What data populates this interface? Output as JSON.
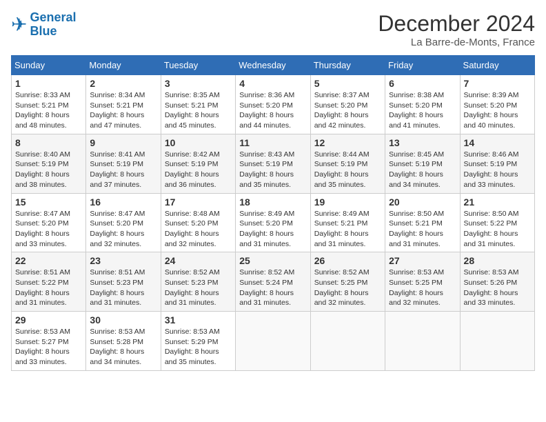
{
  "header": {
    "logo_line1": "General",
    "logo_line2": "Blue",
    "title": "December 2024",
    "subtitle": "La Barre-de-Monts, France"
  },
  "weekdays": [
    "Sunday",
    "Monday",
    "Tuesday",
    "Wednesday",
    "Thursday",
    "Friday",
    "Saturday"
  ],
  "weeks": [
    [
      {
        "day": "1",
        "lines": [
          "Sunrise: 8:33 AM",
          "Sunset: 5:21 PM",
          "Daylight: 8 hours",
          "and 48 minutes."
        ]
      },
      {
        "day": "2",
        "lines": [
          "Sunrise: 8:34 AM",
          "Sunset: 5:21 PM",
          "Daylight: 8 hours",
          "and 47 minutes."
        ]
      },
      {
        "day": "3",
        "lines": [
          "Sunrise: 8:35 AM",
          "Sunset: 5:21 PM",
          "Daylight: 8 hours",
          "and 45 minutes."
        ]
      },
      {
        "day": "4",
        "lines": [
          "Sunrise: 8:36 AM",
          "Sunset: 5:20 PM",
          "Daylight: 8 hours",
          "and 44 minutes."
        ]
      },
      {
        "day": "5",
        "lines": [
          "Sunrise: 8:37 AM",
          "Sunset: 5:20 PM",
          "Daylight: 8 hours",
          "and 42 minutes."
        ]
      },
      {
        "day": "6",
        "lines": [
          "Sunrise: 8:38 AM",
          "Sunset: 5:20 PM",
          "Daylight: 8 hours",
          "and 41 minutes."
        ]
      },
      {
        "day": "7",
        "lines": [
          "Sunrise: 8:39 AM",
          "Sunset: 5:20 PM",
          "Daylight: 8 hours",
          "and 40 minutes."
        ]
      }
    ],
    [
      {
        "day": "8",
        "lines": [
          "Sunrise: 8:40 AM",
          "Sunset: 5:19 PM",
          "Daylight: 8 hours",
          "and 38 minutes."
        ]
      },
      {
        "day": "9",
        "lines": [
          "Sunrise: 8:41 AM",
          "Sunset: 5:19 PM",
          "Daylight: 8 hours",
          "and 37 minutes."
        ]
      },
      {
        "day": "10",
        "lines": [
          "Sunrise: 8:42 AM",
          "Sunset: 5:19 PM",
          "Daylight: 8 hours",
          "and 36 minutes."
        ]
      },
      {
        "day": "11",
        "lines": [
          "Sunrise: 8:43 AM",
          "Sunset: 5:19 PM",
          "Daylight: 8 hours",
          "and 35 minutes."
        ]
      },
      {
        "day": "12",
        "lines": [
          "Sunrise: 8:44 AM",
          "Sunset: 5:19 PM",
          "Daylight: 8 hours",
          "and 35 minutes."
        ]
      },
      {
        "day": "13",
        "lines": [
          "Sunrise: 8:45 AM",
          "Sunset: 5:19 PM",
          "Daylight: 8 hours",
          "and 34 minutes."
        ]
      },
      {
        "day": "14",
        "lines": [
          "Sunrise: 8:46 AM",
          "Sunset: 5:19 PM",
          "Daylight: 8 hours",
          "and 33 minutes."
        ]
      }
    ],
    [
      {
        "day": "15",
        "lines": [
          "Sunrise: 8:47 AM",
          "Sunset: 5:20 PM",
          "Daylight: 8 hours",
          "and 33 minutes."
        ]
      },
      {
        "day": "16",
        "lines": [
          "Sunrise: 8:47 AM",
          "Sunset: 5:20 PM",
          "Daylight: 8 hours",
          "and 32 minutes."
        ]
      },
      {
        "day": "17",
        "lines": [
          "Sunrise: 8:48 AM",
          "Sunset: 5:20 PM",
          "Daylight: 8 hours",
          "and 32 minutes."
        ]
      },
      {
        "day": "18",
        "lines": [
          "Sunrise: 8:49 AM",
          "Sunset: 5:20 PM",
          "Daylight: 8 hours",
          "and 31 minutes."
        ]
      },
      {
        "day": "19",
        "lines": [
          "Sunrise: 8:49 AM",
          "Sunset: 5:21 PM",
          "Daylight: 8 hours",
          "and 31 minutes."
        ]
      },
      {
        "day": "20",
        "lines": [
          "Sunrise: 8:50 AM",
          "Sunset: 5:21 PM",
          "Daylight: 8 hours",
          "and 31 minutes."
        ]
      },
      {
        "day": "21",
        "lines": [
          "Sunrise: 8:50 AM",
          "Sunset: 5:22 PM",
          "Daylight: 8 hours",
          "and 31 minutes."
        ]
      }
    ],
    [
      {
        "day": "22",
        "lines": [
          "Sunrise: 8:51 AM",
          "Sunset: 5:22 PM",
          "Daylight: 8 hours",
          "and 31 minutes."
        ]
      },
      {
        "day": "23",
        "lines": [
          "Sunrise: 8:51 AM",
          "Sunset: 5:23 PM",
          "Daylight: 8 hours",
          "and 31 minutes."
        ]
      },
      {
        "day": "24",
        "lines": [
          "Sunrise: 8:52 AM",
          "Sunset: 5:23 PM",
          "Daylight: 8 hours",
          "and 31 minutes."
        ]
      },
      {
        "day": "25",
        "lines": [
          "Sunrise: 8:52 AM",
          "Sunset: 5:24 PM",
          "Daylight: 8 hours",
          "and 31 minutes."
        ]
      },
      {
        "day": "26",
        "lines": [
          "Sunrise: 8:52 AM",
          "Sunset: 5:25 PM",
          "Daylight: 8 hours",
          "and 32 minutes."
        ]
      },
      {
        "day": "27",
        "lines": [
          "Sunrise: 8:53 AM",
          "Sunset: 5:25 PM",
          "Daylight: 8 hours",
          "and 32 minutes."
        ]
      },
      {
        "day": "28",
        "lines": [
          "Sunrise: 8:53 AM",
          "Sunset: 5:26 PM",
          "Daylight: 8 hours",
          "and 33 minutes."
        ]
      }
    ],
    [
      {
        "day": "29",
        "lines": [
          "Sunrise: 8:53 AM",
          "Sunset: 5:27 PM",
          "Daylight: 8 hours",
          "and 33 minutes."
        ]
      },
      {
        "day": "30",
        "lines": [
          "Sunrise: 8:53 AM",
          "Sunset: 5:28 PM",
          "Daylight: 8 hours",
          "and 34 minutes."
        ]
      },
      {
        "day": "31",
        "lines": [
          "Sunrise: 8:53 AM",
          "Sunset: 5:29 PM",
          "Daylight: 8 hours",
          "and 35 minutes."
        ]
      },
      null,
      null,
      null,
      null
    ]
  ]
}
